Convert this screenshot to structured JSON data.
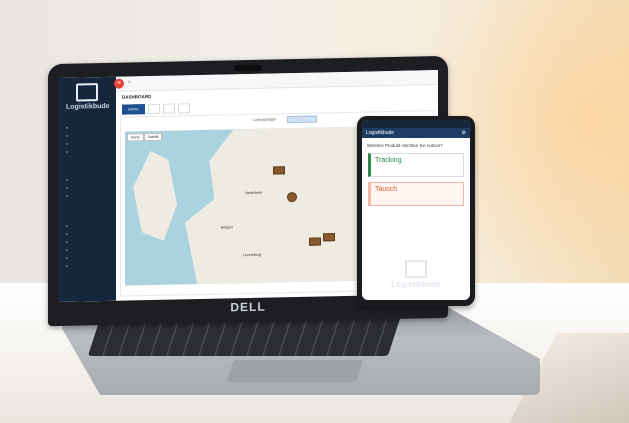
{
  "laptop": {
    "brand": "DELL",
    "app": {
      "logo_text": "Logistikbude",
      "sidebar": {
        "section1": "",
        "items1": [
          "",
          "",
          "",
          ""
        ],
        "section2": "",
        "items2": [
          "",
          "",
          ""
        ],
        "section3": "",
        "items3": [
          "",
          "",
          "",
          "",
          "",
          ""
        ]
      },
      "topbar": {
        "menu_icon": "menu-icon",
        "search_icon": "search-icon",
        "user_name": "",
        "user_sub": ""
      },
      "page_title": "DASHBOARD",
      "tabs": [
        "KARTE",
        "",
        "",
        ""
      ],
      "card": {
        "title": "",
        "language_label": "Ladungsträger",
        "language_value": ""
      },
      "map": {
        "buttons": [
          "Karte",
          "Satellit"
        ],
        "labels": [
          {
            "text": "Nederland"
          },
          {
            "text": "Belgien"
          },
          {
            "text": "Luxemburg"
          }
        ],
        "pins": 4
      },
      "footer": ""
    }
  },
  "phone": {
    "status_time": "",
    "status_right": "",
    "header_title": "Logistikbude",
    "question": "Welches Produkt möchten Sie nutzen?",
    "cards": [
      {
        "title": "Tracking",
        "desc": "",
        "accent": "#2a8a4a"
      },
      {
        "title": "Tausch",
        "desc": "",
        "accent": "#e15b35"
      }
    ],
    "watermark": "Logistikbude"
  },
  "colors": {
    "sidebar": "#16263d",
    "primary": "#1e4f91",
    "menu_button": "#e8433b",
    "map_water": "#aad3df",
    "map_land": "#eeebe3",
    "pin": "#8a5a2e"
  }
}
